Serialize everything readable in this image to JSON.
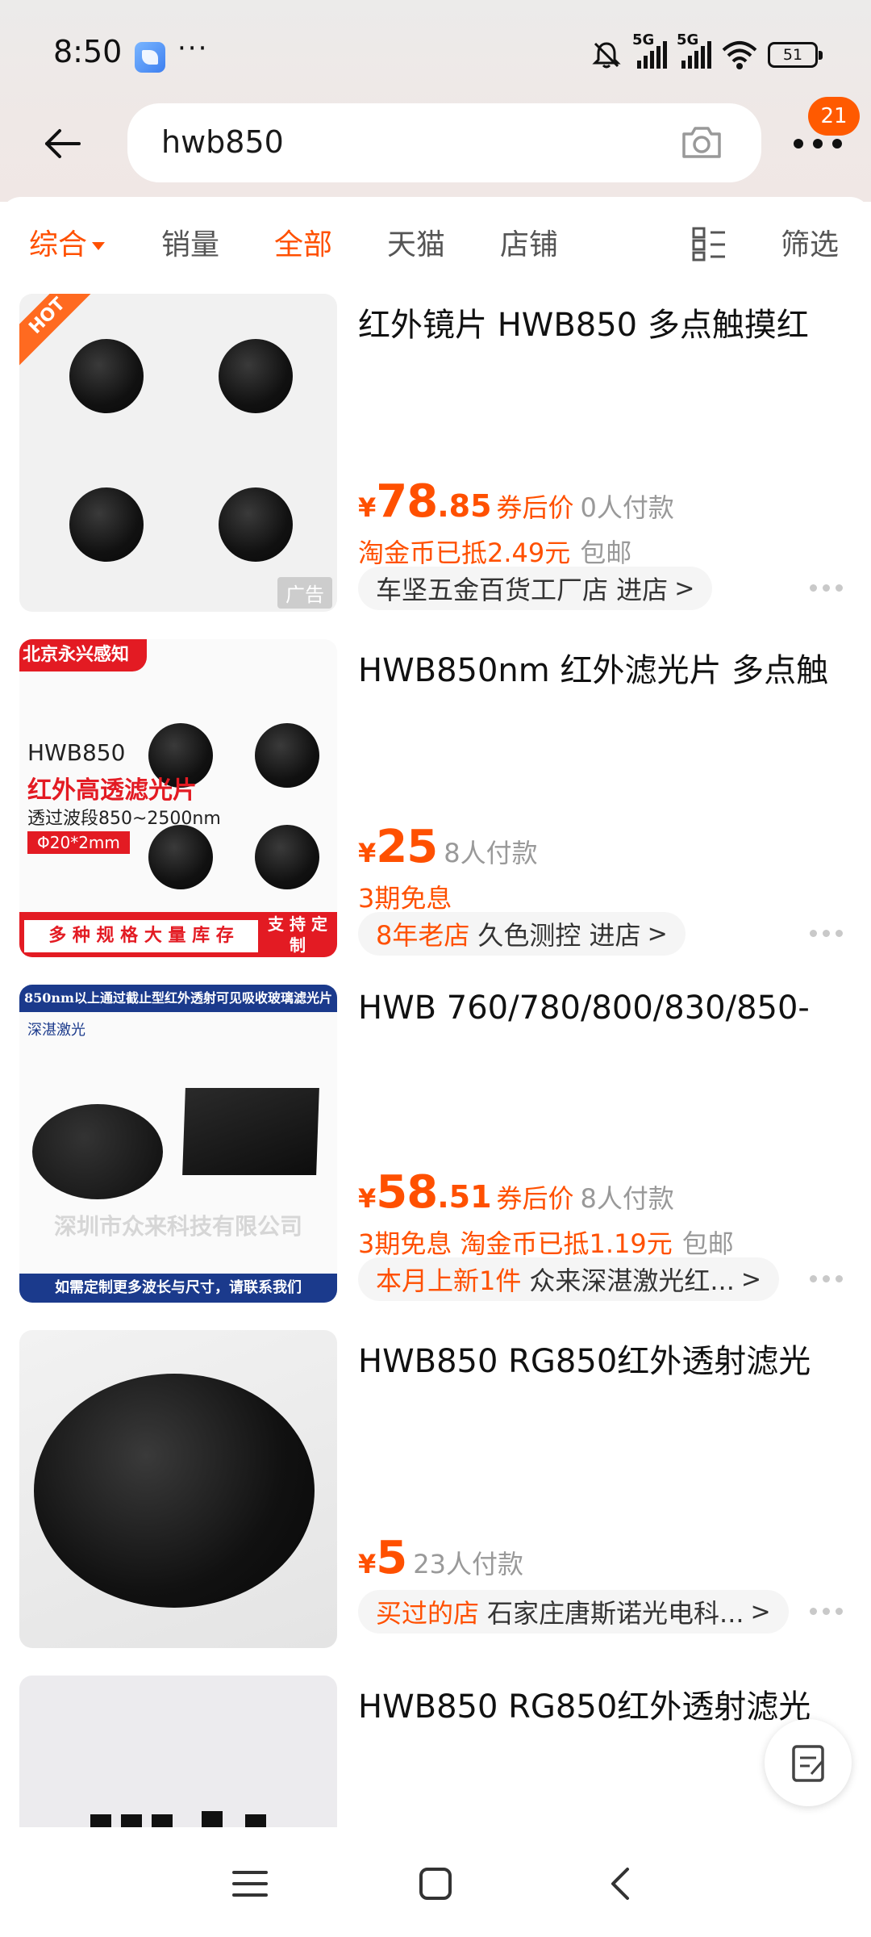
{
  "status": {
    "time": "8:50",
    "more": "···",
    "signal_label_1": "5G",
    "signal_label_2": "5G",
    "battery": "51"
  },
  "header": {
    "query": "hwb850",
    "menu_badge": "21"
  },
  "tabs": [
    {
      "label": "综合",
      "active": true
    },
    {
      "label": "销量",
      "active": false
    },
    {
      "label": "全部",
      "active": true
    },
    {
      "label": "天猫",
      "active": false
    },
    {
      "label": "店铺",
      "active": false
    },
    {
      "label": "筛选",
      "active": false
    }
  ],
  "products": [
    {
      "title": "红外镜片 HWB850 多点触摸红",
      "price_yen": "¥",
      "price_int": "78",
      "price_dec": ".85",
      "coupon": "券后价",
      "sales": "0人付款",
      "promo_orange": "淘金币已抵2.49元",
      "promo_gray": "包邮",
      "shop_tag": "",
      "shop_name": "车坚五金百货工厂店 进店",
      "hot_badge": "HOT",
      "ad_label": "广告"
    },
    {
      "title": "HWB850nm 红外滤光片 多点触",
      "price_yen": "¥",
      "price_int": "25",
      "price_dec": "",
      "coupon": "",
      "sales": "8人付款",
      "promo_orange": "3期免息",
      "promo_gray": "",
      "shop_tag": "8年老店",
      "shop_name": "久色测控 进店",
      "thumb": {
        "banner": "北京永兴感知",
        "model": "HWB850",
        "headline": "红外高透滤光片",
        "range": "透过波段850~2500nm",
        "size": "Φ20*2mm",
        "bottom_left": "多 种 规 格  大 量 库 存",
        "bottom_right": "支 持 定 制"
      }
    },
    {
      "title": "HWB 760/780/800/830/850-",
      "price_yen": "¥",
      "price_int": "58",
      "price_dec": ".51",
      "coupon": "券后价",
      "sales": "8人付款",
      "promo_orange": "3期免息  淘金币已抵1.19元",
      "promo_gray": "包邮",
      "shop_tag": "本月上新1件",
      "shop_name": "众来深湛激光红...",
      "thumb": {
        "top": "850nm以上通过截止型红外透射可见吸收玻璃滤光片",
        "logo": "深湛激光",
        "watermark": "深圳市众来科技有限公司",
        "bottom": "如需定制更多波长与尺寸，请联系我们"
      }
    },
    {
      "title": "HWB850 RG850红外透射滤光",
      "price_yen": "¥",
      "price_int": "5",
      "price_dec": "",
      "coupon": "",
      "sales": "23人付款",
      "promo_orange": "",
      "promo_gray": "",
      "shop_tag": "买过的店",
      "shop_name": "石家庄唐斯诺光电科...",
      "hot_badge": ""
    },
    {
      "title": "HWB850 RG850红外透射滤光"
    }
  ],
  "colors": {
    "accent": "#ff5000",
    "badge": "#ff5a00"
  },
  "icons": [
    "back-arrow-icon",
    "camera-icon",
    "more-dots-icon",
    "list-grid-icon",
    "edit-feedback-icon",
    "menu-nav-icon",
    "home-nav-icon",
    "back-nav-icon"
  ]
}
